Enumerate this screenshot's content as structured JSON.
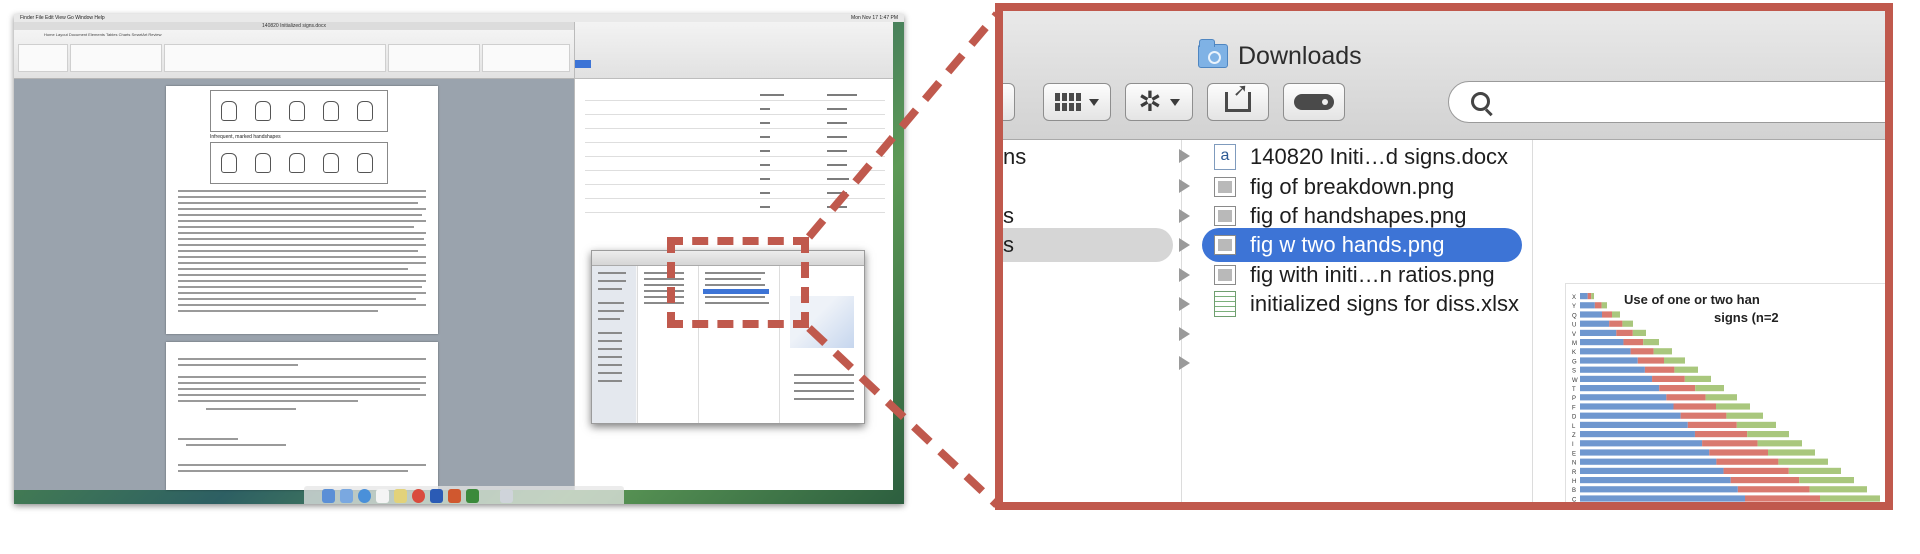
{
  "desktop": {
    "menubar": {
      "left": "Finder  File  Edit  View  Go  Window  Help",
      "right": "Mon Nov 17  1:47 PM"
    },
    "word": {
      "title": "140820 Initialized signs.docx",
      "tabs": "Home  Layout  Document Elements  Tables  Charts  SmartArt  Review",
      "figure_labels": [
        "Widespread, unmarked handshapes",
        "Infrequent, marked handshapes"
      ]
    },
    "dock": {
      "icons": [
        "finder",
        "mail",
        "safari",
        "calendar",
        "notes",
        "chrome",
        "word",
        "powerpoint",
        "excel",
        "trash"
      ]
    }
  },
  "zoom": {
    "folder_title": "Downloads",
    "toolbar": {
      "view_button": "view-options",
      "action_button": "action-gear",
      "share_button": "share",
      "tag_button": "edit-tags"
    },
    "sidebar_fragments": [
      {
        "text": "ns"
      },
      {
        "text": "s"
      },
      {
        "text": "s"
      }
    ],
    "files": [
      {
        "name": "140820 Initi…d signs.docx",
        "kind": "docx",
        "selected": false
      },
      {
        "name": "fig of breakdown.png",
        "kind": "png",
        "selected": false
      },
      {
        "name": "fig of handshapes.png",
        "kind": "png",
        "selected": false
      },
      {
        "name": "fig w two hands.png",
        "kind": "png",
        "selected": true
      },
      {
        "name": "fig with initi…n ratios.png",
        "kind": "png",
        "selected": false
      },
      {
        "name": "initialized signs for diss.xlsx",
        "kind": "xlsx",
        "selected": false
      }
    ],
    "preview": {
      "title_line1": "Use of one or two han",
      "title_line2": "signs (n=2",
      "legend_letters": [
        "X",
        "Y",
        "Q",
        "U",
        "V",
        "M",
        "K",
        "G",
        "S",
        "W",
        "T",
        "P",
        "F",
        "D",
        "L",
        "Z",
        "I",
        "E",
        "N",
        "R",
        "H",
        "B",
        "C",
        "A"
      ],
      "series_colors": {
        "one_hand": "#6f97cf",
        "two_hands": "#d9796f",
        "other": "#a9c77d"
      }
    }
  },
  "colors": {
    "highlight_border": "#c0594d",
    "selection": "#3d74d6"
  }
}
